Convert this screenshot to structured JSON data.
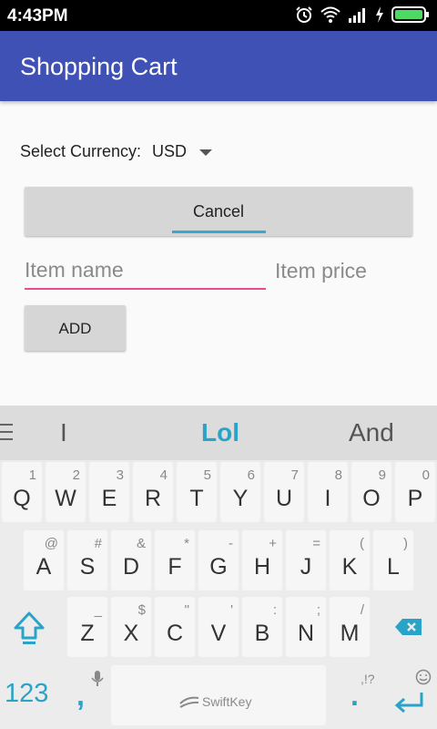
{
  "status": {
    "time": "4:43PM",
    "icons": [
      "alarm-icon",
      "wifi-icon",
      "signal-icon",
      "charging-icon",
      "battery-icon"
    ]
  },
  "appbar": {
    "title": "Shopping Cart"
  },
  "form": {
    "currency_label": "Select Currency:",
    "currency_value": "USD",
    "cancel_label": "Cancel",
    "item_name_placeholder": "Item name",
    "item_price_placeholder": "Item price",
    "add_label": "ADD"
  },
  "keyboard": {
    "suggestions": [
      "I",
      "Lol",
      "And"
    ],
    "row1": [
      {
        "k": "Q",
        "h": "1"
      },
      {
        "k": "W",
        "h": "2"
      },
      {
        "k": "E",
        "h": "3"
      },
      {
        "k": "R",
        "h": "4"
      },
      {
        "k": "T",
        "h": "5"
      },
      {
        "k": "Y",
        "h": "6"
      },
      {
        "k": "U",
        "h": "7"
      },
      {
        "k": "I",
        "h": "8"
      },
      {
        "k": "O",
        "h": "9"
      },
      {
        "k": "P",
        "h": "0"
      }
    ],
    "row2": [
      {
        "k": "A",
        "h": "@"
      },
      {
        "k": "S",
        "h": "#"
      },
      {
        "k": "D",
        "h": "&"
      },
      {
        "k": "F",
        "h": "*"
      },
      {
        "k": "G",
        "h": "-"
      },
      {
        "k": "H",
        "h": "+"
      },
      {
        "k": "J",
        "h": "="
      },
      {
        "k": "K",
        "h": "("
      },
      {
        "k": "L",
        "h": ")"
      }
    ],
    "row3": [
      {
        "k": "Z",
        "h": "_"
      },
      {
        "k": "X",
        "h": "$"
      },
      {
        "k": "C",
        "h": "\""
      },
      {
        "k": "V",
        "h": "'"
      },
      {
        "k": "B",
        "h": ":"
      },
      {
        "k": "N",
        "h": ";"
      },
      {
        "k": "M",
        "h": "/"
      }
    ],
    "numbers_label": "123",
    "comma": ",",
    "space_brand": "SwiftKey",
    "period": ".",
    "punct_hint": ",!?",
    "accent_color": "#2aa3c8"
  }
}
